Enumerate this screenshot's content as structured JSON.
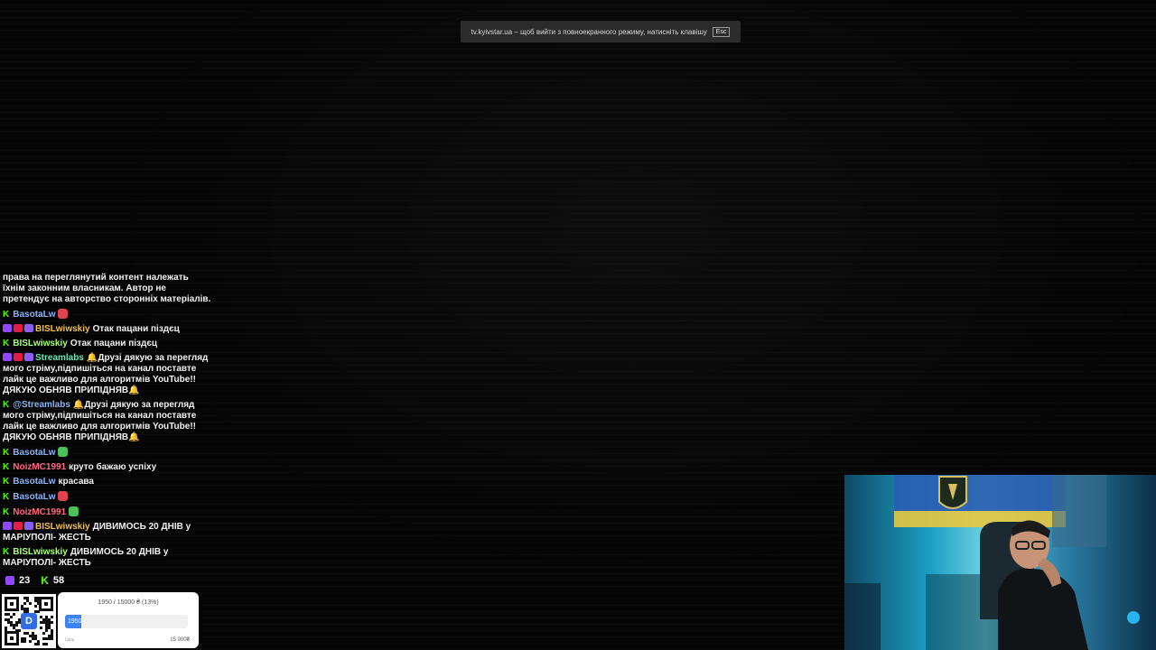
{
  "fullscreen_notice": {
    "text": "tv.kyivstar.ua – щоб вийти з повноекранного режиму, натисніть клавішу",
    "key": "Esc"
  },
  "chat": {
    "partial_top": "права на переглянутий контент належать їхнім законним власникам. Автор не претендує на авторство сторонніх матеріалів.",
    "messages": [
      {
        "platform": "kick",
        "name": "BasotaLw",
        "name_color": "#8ab4f8",
        "text": "",
        "emote": "red"
      },
      {
        "platform": "twitch",
        "name": "BISLwiwskiy",
        "name_color": "#f0c050",
        "text": "Отак пацани піздєц"
      },
      {
        "platform": "kick",
        "name": "BISLwiwskiy",
        "name_color": "#a8ff78",
        "text": "Отак пацани піздєц"
      },
      {
        "platform": "twitch",
        "name": "Streamlabs",
        "name_color": "#6ee7b7",
        "text": "🔔Друзі дякую за перегляд мого стріму,підпишіться на канал поставте лайк це важливо для алгоритмів YouTube!!ДЯКУЮ ОБНЯВ ПРИПІДНЯВ🔔"
      },
      {
        "platform": "kick",
        "name": "@Streamlabs",
        "name_color": "#8ab4f8",
        "text": "🔔Друзі дякую за перегляд мого стріму,підпишіться на канал поставте лайк це важливо для алгоритмів YouTube!!ДЯКУЮ ОБНЯВ ПРИПІДНЯВ🔔"
      },
      {
        "platform": "kick",
        "name": "BasotaLw",
        "name_color": "#8ab4f8",
        "text": "",
        "emote": "green"
      },
      {
        "platform": "kick",
        "name": "NoizMC1991",
        "name_color": "#ff6b81",
        "text": "круто бажаю успіху"
      },
      {
        "platform": "kick",
        "name": "BasotaLw",
        "name_color": "#8ab4f8",
        "text": "красава"
      },
      {
        "platform": "kick",
        "name": "BasotaLw",
        "name_color": "#8ab4f8",
        "text": "",
        "emote": "red"
      },
      {
        "platform": "kick",
        "name": "NoizMC1991",
        "name_color": "#ff6b81",
        "text": "",
        "emote": "green"
      },
      {
        "platform": "twitch",
        "name": "BISLwiwskiy",
        "name_color": "#f0c050",
        "text": "ДИВИМОСЬ 20 ДНІВ у МАРІУПОЛІ- ЖЕСТЬ"
      },
      {
        "platform": "kick",
        "name": "BISLwiwskiy",
        "name_color": "#a8ff78",
        "text": "ДИВИМОСЬ 20 ДНІВ у МАРІУПОЛІ- ЖЕСТЬ"
      }
    ]
  },
  "viewers": {
    "twitch": "23",
    "kick": "58"
  },
  "donation": {
    "goal_text": "1950 / 15000 ₴ (13%)",
    "fill_label": "1950",
    "progress": 0.13,
    "min_label": "Ціль",
    "max_label": "15 000₴"
  },
  "qr": {
    "logo_text": "D"
  },
  "colors": {
    "kick": "#53fc18",
    "twitch": "#9146ff",
    "donation_fill": "#3b82f6"
  }
}
